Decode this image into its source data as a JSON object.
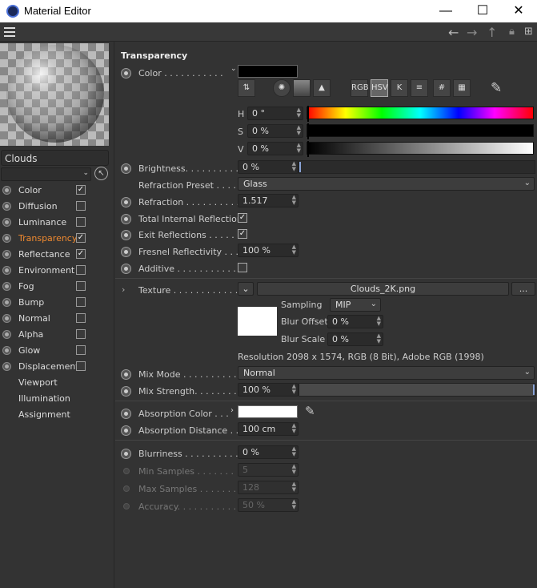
{
  "window": {
    "title": "Material Editor",
    "minimize": "—",
    "maximize": "☐",
    "close": "✕"
  },
  "toolbar": {
    "icons": [
      "back-arrow-icon",
      "forward-arrow-icon",
      "up-arrow-icon",
      "lock-icon",
      "new-window-icon"
    ]
  },
  "left": {
    "material_name": "Clouds",
    "channels": [
      {
        "label": "Color",
        "checked": true
      },
      {
        "label": "Diffusion",
        "checked": false
      },
      {
        "label": "Luminance",
        "checked": false
      },
      {
        "label": "Transparency",
        "checked": true,
        "active": true
      },
      {
        "label": "Reflectance",
        "checked": true
      },
      {
        "label": "Environment",
        "checked": false
      },
      {
        "label": "Fog",
        "checked": false
      },
      {
        "label": "Bump",
        "checked": false
      },
      {
        "label": "Normal",
        "checked": false
      },
      {
        "label": "Alpha",
        "checked": false
      },
      {
        "label": "Glow",
        "checked": false
      },
      {
        "label": "Displacement",
        "checked": false
      },
      {
        "label": "Viewport"
      },
      {
        "label": "Illumination"
      },
      {
        "label": "Assignment"
      }
    ]
  },
  "transparency": {
    "section_title": "Transparency",
    "color_label": "Color . . . . . . . . . . .",
    "color_swatch": "#000000",
    "color_tools": [
      "RGB",
      "HSV",
      "K",
      "≡",
      "#",
      "▦"
    ],
    "h_label": "H",
    "h_value": "0 °",
    "s_label": "S",
    "s_value": "0 %",
    "v_label": "V",
    "v_value": "0 %",
    "brightness_label": "Brightness. . . . . . . . . .",
    "brightness_value": "0 %",
    "refraction_preset_label": "Refraction Preset . . . . .",
    "refraction_preset_value": "Glass",
    "refraction_label": "Refraction . . . . . . . . . .",
    "refraction_value": "1.517",
    "tir_label": "Total Internal Reflection",
    "exit_label": "Exit Reflections . . . . . .",
    "fresnel_label": "Fresnel Reflectivity . . . .",
    "fresnel_value": "100 %",
    "additive_label": "Additive . . . . . . . . . . . .",
    "texture_label": "Texture . . . . . . . . . . . .",
    "texture_file": "Clouds_2K.png",
    "texture_more": "...",
    "sampling_label": "Sampling",
    "sampling_value": "MIP",
    "blur_offset_label": "Blur Offset",
    "blur_offset_value": "0 %",
    "blur_scale_label": "Blur Scale",
    "blur_scale_value": "0 %",
    "resolution_text": "Resolution 2098 x 1574, RGB (8 Bit), Adobe RGB (1998)",
    "mix_mode_label": "Mix Mode . . . . . . . . . .",
    "mix_mode_value": "Normal",
    "mix_strength_label": "Mix Strength. . . . . . . .",
    "mix_strength_value": "100 %",
    "absorption_color_label": "Absorption Color . . .",
    "absorption_color": "#ffffff",
    "absorption_distance_label": "Absorption Distance . .",
    "absorption_distance_value": "100 cm",
    "blurriness_label": "Blurriness . . . . . . . . . .",
    "blurriness_value": "0 %",
    "min_samples_label": "Min Samples . . . . . . .",
    "min_samples_value": "5",
    "max_samples_label": "Max Samples . . . . . . .",
    "max_samples_value": "128",
    "accuracy_label": "Accuracy. . . . . . . . . . .",
    "accuracy_value": "50 %"
  }
}
